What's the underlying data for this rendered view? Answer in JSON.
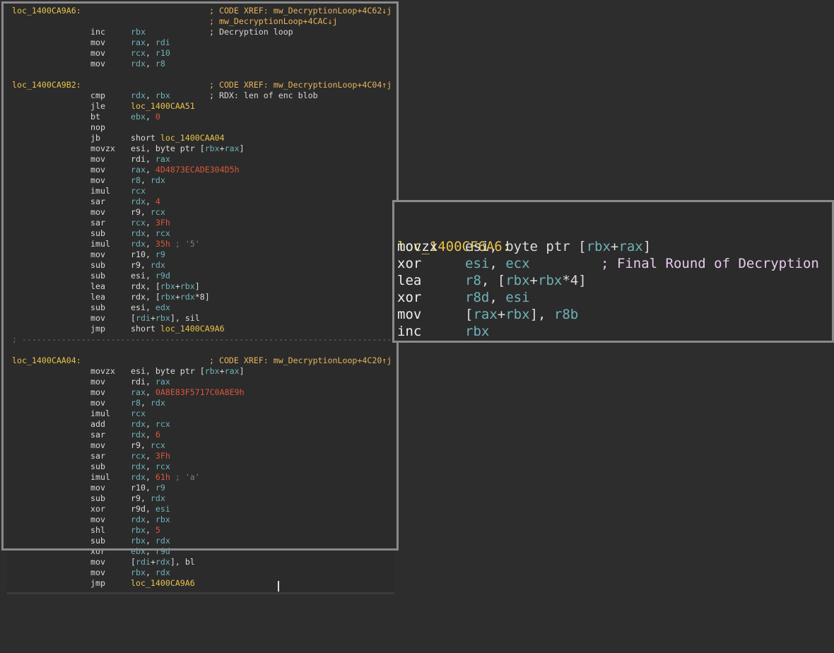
{
  "left": {
    "blocks": [
      {
        "kind": "code",
        "label": "loc_1400CA9A6:",
        "comment": "; CODE XREF: mw_DecryptionLoop+4C62↓j"
      },
      {
        "kind": "code",
        "comment": "; mw_DecryptionLoop+4CAC↓j"
      },
      {
        "kind": "code",
        "mn": "inc",
        "ops": [
          [
            "reg",
            "rbx"
          ]
        ],
        "comment": "; Decryption loop",
        "comment_style": "text"
      },
      {
        "kind": "code",
        "mn": "mov",
        "ops": [
          [
            "reg",
            "rax"
          ],
          [
            "txt",
            ", "
          ],
          [
            "reg",
            "rdi"
          ]
        ]
      },
      {
        "kind": "code",
        "mn": "mov",
        "ops": [
          [
            "reg",
            "rcx"
          ],
          [
            "txt",
            ", "
          ],
          [
            "reg",
            "r10"
          ]
        ]
      },
      {
        "kind": "code",
        "mn": "mov",
        "ops": [
          [
            "reg",
            "rdx"
          ],
          [
            "txt",
            ", "
          ],
          [
            "reg",
            "r8"
          ]
        ]
      },
      {
        "kind": "blank"
      },
      {
        "kind": "code",
        "label": "loc_1400CA9B2:",
        "comment": "; CODE XREF: mw_DecryptionLoop+4C04↑j"
      },
      {
        "kind": "code",
        "mn": "cmp",
        "ops": [
          [
            "reg",
            "rdx"
          ],
          [
            "txt",
            ", "
          ],
          [
            "reg",
            "rbx"
          ]
        ],
        "comment": "; RDX: len of enc blob",
        "comment_style": "text"
      },
      {
        "kind": "code",
        "mn": "jle",
        "ops": [
          [
            "lref",
            "loc_1400CAA51"
          ]
        ]
      },
      {
        "kind": "code",
        "mn": "bt",
        "ops": [
          [
            "reg",
            "ebx"
          ],
          [
            "txt",
            ", "
          ],
          [
            "num",
            "0"
          ]
        ]
      },
      {
        "kind": "code",
        "mn": "nop"
      },
      {
        "kind": "code",
        "mn": "jb",
        "ops": [
          [
            "txt",
            "short "
          ],
          [
            "lref",
            "loc_1400CAA04"
          ]
        ]
      },
      {
        "kind": "code",
        "mn": "movzx",
        "ops": [
          [
            "txt",
            "esi, byte ptr ["
          ],
          [
            "reg",
            "rbx"
          ],
          [
            "txt",
            "+"
          ],
          [
            "reg",
            "rax"
          ],
          [
            "txt",
            "]"
          ]
        ]
      },
      {
        "kind": "code",
        "mn": "mov",
        "ops": [
          [
            "txt",
            "rdi, "
          ],
          [
            "reg",
            "rax"
          ]
        ]
      },
      {
        "kind": "code",
        "mn": "mov",
        "ops": [
          [
            "reg",
            "rax"
          ],
          [
            "txt",
            ", "
          ],
          [
            "num",
            "4D4873ECADE304D5h"
          ]
        ]
      },
      {
        "kind": "code",
        "mn": "mov",
        "ops": [
          [
            "reg",
            "r8"
          ],
          [
            "txt",
            ", "
          ],
          [
            "reg",
            "rdx"
          ]
        ]
      },
      {
        "kind": "code",
        "mn": "imul",
        "ops": [
          [
            "reg",
            "rcx"
          ]
        ]
      },
      {
        "kind": "code",
        "mn": "sar",
        "ops": [
          [
            "reg",
            "rdx"
          ],
          [
            "txt",
            ", "
          ],
          [
            "num",
            "4"
          ]
        ]
      },
      {
        "kind": "code",
        "mn": "mov",
        "ops": [
          [
            "txt",
            "r9, "
          ],
          [
            "reg",
            "rcx"
          ]
        ]
      },
      {
        "kind": "code",
        "mn": "sar",
        "ops": [
          [
            "reg",
            "rcx"
          ],
          [
            "txt",
            ", "
          ],
          [
            "num",
            "3Fh"
          ]
        ]
      },
      {
        "kind": "code",
        "mn": "sub",
        "ops": [
          [
            "reg",
            "rdx"
          ],
          [
            "txt",
            ", "
          ],
          [
            "reg",
            "rcx"
          ]
        ]
      },
      {
        "kind": "code",
        "mn": "imul",
        "ops": [
          [
            "reg",
            "rdx"
          ],
          [
            "txt",
            ", "
          ],
          [
            "num",
            "35h"
          ],
          [
            "cmt",
            " ; '5'"
          ]
        ]
      },
      {
        "kind": "code",
        "mn": "mov",
        "ops": [
          [
            "txt",
            "r10, "
          ],
          [
            "reg",
            "r9"
          ]
        ]
      },
      {
        "kind": "code",
        "mn": "sub",
        "ops": [
          [
            "txt",
            "r9, "
          ],
          [
            "reg",
            "rdx"
          ]
        ]
      },
      {
        "kind": "code",
        "mn": "sub",
        "ops": [
          [
            "txt",
            "esi, "
          ],
          [
            "reg",
            "r9d"
          ]
        ]
      },
      {
        "kind": "code",
        "mn": "lea",
        "ops": [
          [
            "txt",
            "rdx, ["
          ],
          [
            "reg",
            "rbx"
          ],
          [
            "txt",
            "+"
          ],
          [
            "reg",
            "rbx"
          ],
          [
            "txt",
            "]"
          ]
        ]
      },
      {
        "kind": "code",
        "mn": "lea",
        "ops": [
          [
            "txt",
            "rdx, ["
          ],
          [
            "reg",
            "rbx"
          ],
          [
            "txt",
            "+"
          ],
          [
            "reg",
            "rdx"
          ],
          [
            "txt",
            "*8]"
          ]
        ]
      },
      {
        "kind": "code",
        "mn": "sub",
        "ops": [
          [
            "txt",
            "esi, "
          ],
          [
            "reg",
            "edx"
          ]
        ]
      },
      {
        "kind": "code",
        "mn": "mov",
        "ops": [
          [
            "txt",
            "["
          ],
          [
            "reg",
            "rdi"
          ],
          [
            "txt",
            "+"
          ],
          [
            "reg",
            "rbx"
          ],
          [
            "txt",
            "], sil"
          ]
        ]
      },
      {
        "kind": "code",
        "mn": "jmp",
        "ops": [
          [
            "txt",
            "short "
          ],
          [
            "lref",
            "loc_1400CA9A6"
          ]
        ]
      },
      {
        "kind": "sep",
        "text": "; ---------------------------------------------------------------------------"
      },
      {
        "kind": "blank"
      },
      {
        "kind": "code",
        "label": "loc_1400CAA04:",
        "comment": "; CODE XREF: mw_DecryptionLoop+4C20↑j"
      },
      {
        "kind": "code",
        "mn": "movzx",
        "ops": [
          [
            "txt",
            "esi, byte ptr ["
          ],
          [
            "reg",
            "rbx"
          ],
          [
            "txt",
            "+"
          ],
          [
            "reg",
            "rax"
          ],
          [
            "txt",
            "]"
          ]
        ]
      },
      {
        "kind": "code",
        "mn": "mov",
        "ops": [
          [
            "txt",
            "rdi, "
          ],
          [
            "reg",
            "rax"
          ]
        ]
      },
      {
        "kind": "code",
        "mn": "mov",
        "ops": [
          [
            "reg",
            "rax"
          ],
          [
            "txt",
            ", "
          ],
          [
            "num",
            "0A8E83F5717C0A8E9h"
          ]
        ]
      },
      {
        "kind": "code",
        "mn": "mov",
        "ops": [
          [
            "reg",
            "r8"
          ],
          [
            "txt",
            ", "
          ],
          [
            "reg",
            "rdx"
          ]
        ]
      },
      {
        "kind": "code",
        "mn": "imul",
        "ops": [
          [
            "reg",
            "rcx"
          ]
        ]
      },
      {
        "kind": "code",
        "mn": "add",
        "ops": [
          [
            "reg",
            "rdx"
          ],
          [
            "txt",
            ", "
          ],
          [
            "reg",
            "rcx"
          ]
        ]
      },
      {
        "kind": "code",
        "mn": "sar",
        "ops": [
          [
            "reg",
            "rdx"
          ],
          [
            "txt",
            ", "
          ],
          [
            "num",
            "6"
          ]
        ]
      },
      {
        "kind": "code",
        "mn": "mov",
        "ops": [
          [
            "txt",
            "r9, "
          ],
          [
            "reg",
            "rcx"
          ]
        ]
      },
      {
        "kind": "code",
        "mn": "sar",
        "ops": [
          [
            "reg",
            "rcx"
          ],
          [
            "txt",
            ", "
          ],
          [
            "num",
            "3Fh"
          ]
        ]
      },
      {
        "kind": "code",
        "mn": "sub",
        "ops": [
          [
            "reg",
            "rdx"
          ],
          [
            "txt",
            ", "
          ],
          [
            "reg",
            "rcx"
          ]
        ]
      },
      {
        "kind": "code",
        "mn": "imul",
        "ops": [
          [
            "reg",
            "rdx"
          ],
          [
            "txt",
            ", "
          ],
          [
            "num",
            "61h"
          ],
          [
            "cmt",
            " ; 'a'"
          ]
        ]
      },
      {
        "kind": "code",
        "mn": "mov",
        "ops": [
          [
            "txt",
            "r10, "
          ],
          [
            "reg",
            "r9"
          ]
        ]
      },
      {
        "kind": "code",
        "mn": "sub",
        "ops": [
          [
            "txt",
            "r9, "
          ],
          [
            "reg",
            "rdx"
          ]
        ]
      },
      {
        "kind": "code",
        "mn": "xor",
        "ops": [
          [
            "txt",
            "r9d, "
          ],
          [
            "reg",
            "esi"
          ]
        ]
      },
      {
        "kind": "code",
        "mn": "mov",
        "ops": [
          [
            "reg",
            "rdx"
          ],
          [
            "txt",
            ", "
          ],
          [
            "reg",
            "rbx"
          ]
        ]
      },
      {
        "kind": "code",
        "mn": "shl",
        "ops": [
          [
            "reg",
            "rbx"
          ],
          [
            "txt",
            ", "
          ],
          [
            "num",
            "5"
          ]
        ]
      },
      {
        "kind": "code",
        "mn": "sub",
        "ops": [
          [
            "reg",
            "rbx"
          ],
          [
            "txt",
            ", "
          ],
          [
            "reg",
            "rdx"
          ]
        ]
      },
      {
        "kind": "code",
        "mn": "xor",
        "ops": [
          [
            "reg",
            "ebx"
          ],
          [
            "txt",
            ", "
          ],
          [
            "reg",
            "r9d"
          ]
        ]
      },
      {
        "kind": "code",
        "mn": "mov",
        "ops": [
          [
            "txt",
            "["
          ],
          [
            "reg",
            "rdi"
          ],
          [
            "txt",
            "+"
          ],
          [
            "reg",
            "rdx"
          ],
          [
            "txt",
            "], bl"
          ]
        ]
      },
      {
        "kind": "code",
        "mn": "mov",
        "ops": [
          [
            "reg",
            "rbx"
          ],
          [
            "txt",
            ", "
          ],
          [
            "reg",
            "rdx"
          ]
        ]
      },
      {
        "kind": "code",
        "mn": "jmp",
        "ops": [
          [
            "lref",
            "loc_1400CA9A6"
          ]
        ]
      }
    ]
  },
  "right": {
    "label": "loc_1400CF6A6:",
    "comment": "; Final Round of Decryption",
    "lines": [
      {
        "mn": "movzx",
        "ops": [
          [
            "txt",
            "esi, byte ptr ["
          ],
          [
            "reg",
            "rbx"
          ],
          [
            "txt",
            "+"
          ],
          [
            "reg",
            "rax"
          ],
          [
            "txt",
            "]"
          ]
        ]
      },
      {
        "mn": "xor",
        "ops": [
          [
            "reg",
            "esi"
          ],
          [
            "txt",
            ", "
          ],
          [
            "reg",
            "ecx"
          ]
        ]
      },
      {
        "mn": "lea",
        "ops": [
          [
            "reg",
            "r8"
          ],
          [
            "txt",
            ", ["
          ],
          [
            "reg",
            "rbx"
          ],
          [
            "txt",
            "+"
          ],
          [
            "reg",
            "rbx"
          ],
          [
            "txt",
            "*4]"
          ]
        ]
      },
      {
        "mn": "xor",
        "ops": [
          [
            "reg",
            "r8d"
          ],
          [
            "txt",
            ", "
          ],
          [
            "reg",
            "esi"
          ]
        ]
      },
      {
        "mn": "mov",
        "ops": [
          [
            "txt",
            "["
          ],
          [
            "reg",
            "rax"
          ],
          [
            "txt",
            "+"
          ],
          [
            "reg",
            "rbx"
          ],
          [
            "txt",
            "], "
          ],
          [
            "reg",
            "r8b"
          ]
        ]
      },
      {
        "mn": "inc",
        "ops": [
          [
            "reg",
            "rbx"
          ]
        ]
      }
    ]
  }
}
